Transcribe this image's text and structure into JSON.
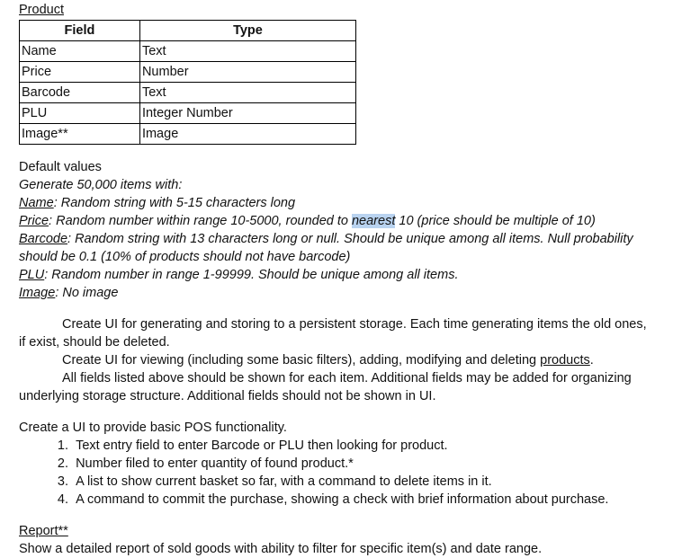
{
  "product": {
    "title": "Product",
    "headers": [
      "Field",
      "Type"
    ],
    "rows": [
      [
        "Name",
        "Text"
      ],
      [
        "Price",
        "Number"
      ],
      [
        "Barcode",
        "Text"
      ],
      [
        "PLU",
        "Integer Number"
      ],
      [
        "Image**",
        "Image"
      ]
    ]
  },
  "defaults": {
    "title": "Default values",
    "generate": "Generate 50,000 items with:",
    "name_label": "Name",
    "name_text": ": Random string with 5-15 characters long",
    "price_label": "Price",
    "price_text_a": ": Random number within range 10-5000, rounded to ",
    "price_highlight": "nearest",
    "price_text_b": " 10 (price should be multiple of 10)",
    "barcode_label": "Barcode",
    "barcode_text_1": ": Random string with 13 characters long or null. Should be unique among all items. Null probability",
    "barcode_text_2": "should be 0.1 (10% of products should not have barcode)",
    "plu_label": "PLU",
    "plu_text": ": Random number in range 1-99999. Should be unique among all items.",
    "image_label": "Image",
    "image_text": ": No image"
  },
  "ui": {
    "p1_line1": "Create UI for generating and storing to a persistent storage. Each time generating items the old ones,",
    "p1_line2": "if exist, should be deleted.",
    "p2_a": "Create UI for viewing (including some basic filters), adding, modifying and deleting ",
    "p2_link": "products",
    "p2_b": ".",
    "p3_line1": "All fields listed above should be shown for each item. Additional fields may be added for organizing",
    "p3_line2": "underlying storage structure. Additional fields should not be shown in UI."
  },
  "pos": {
    "intro": "Create a UI to provide basic POS functionality.",
    "items": [
      {
        "num": "1.",
        "text": "Text entry field to enter Barcode or PLU then looking for product."
      },
      {
        "num": "2.",
        "text": "Number filed to enter quantity of found product.*"
      },
      {
        "num": "3.",
        "text": "A list to show current basket so far, with a command to delete items in it."
      },
      {
        "num": "4.",
        "text": "A command to commit the purchase, showing a check with brief information about purchase."
      }
    ]
  },
  "report": {
    "title": "Report**",
    "text": "Show a detailed report of sold goods with ability to filter for specific item(s) and date range."
  }
}
